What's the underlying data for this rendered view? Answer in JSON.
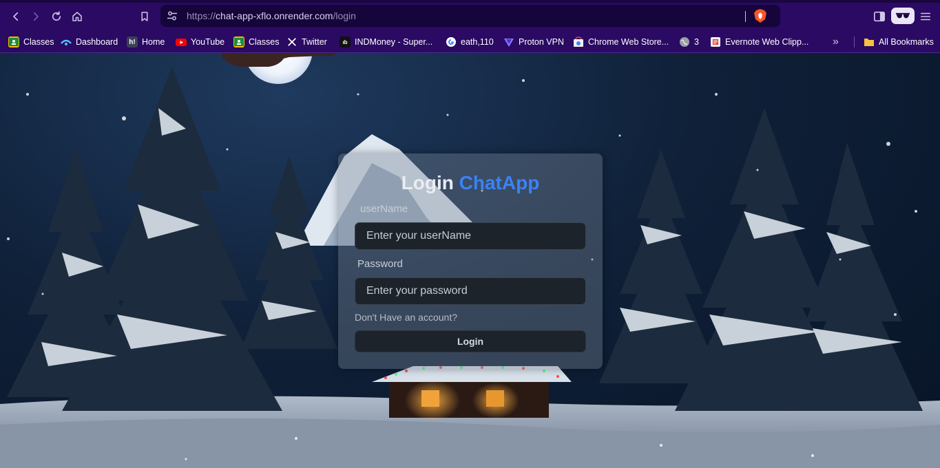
{
  "browser": {
    "url_scheme": "https://",
    "url_host": "chat-app-xflo.onrender.com",
    "url_path": "/login",
    "icons": [
      "back-icon",
      "forward-icon",
      "reload-icon",
      "home-icon",
      "bookmark-icon",
      "site-settings-icon",
      "brave-shield-icon",
      "sidebar-icon",
      "private-glasses-icon",
      "menu-icon"
    ]
  },
  "bookmarks": {
    "items": [
      {
        "label": "Classes",
        "icon": "classroom-icon"
      },
      {
        "label": "Dashboard",
        "icon": "dashboard-icon"
      },
      {
        "label": "Home",
        "icon": "h-icon"
      },
      {
        "label": "YouTube",
        "icon": "youtube-icon"
      },
      {
        "label": "Classes",
        "icon": "classroom-icon"
      },
      {
        "label": "Twitter",
        "icon": "x-icon"
      },
      {
        "label": "INDMoney - Super...",
        "icon": "indmoney-icon"
      },
      {
        "label": "eath,110",
        "icon": "google-icon"
      },
      {
        "label": "Proton VPN",
        "icon": "protonvpn-icon"
      },
      {
        "label": "Chrome Web Store...",
        "icon": "webstore-icon"
      },
      {
        "label": "3",
        "icon": "globe-icon"
      },
      {
        "label": "Evernote Web Clipp...",
        "icon": "evernote-icon"
      }
    ],
    "overflow": "»",
    "all_bookmarks": "All Bookmarks"
  },
  "login": {
    "title_main": "Login",
    "title_accent": "ChatApp",
    "username_label": "userName",
    "username_placeholder": "Enter your userName",
    "username_value": "",
    "password_label": "Password",
    "password_placeholder": "Enter your password",
    "password_value": "",
    "signup_link": "Don't Have an account?",
    "submit_label": "Login"
  },
  "colors": {
    "chrome_bg": "#2a0a63",
    "accent": "#3b82f6",
    "input_bg": "#1d232a"
  }
}
